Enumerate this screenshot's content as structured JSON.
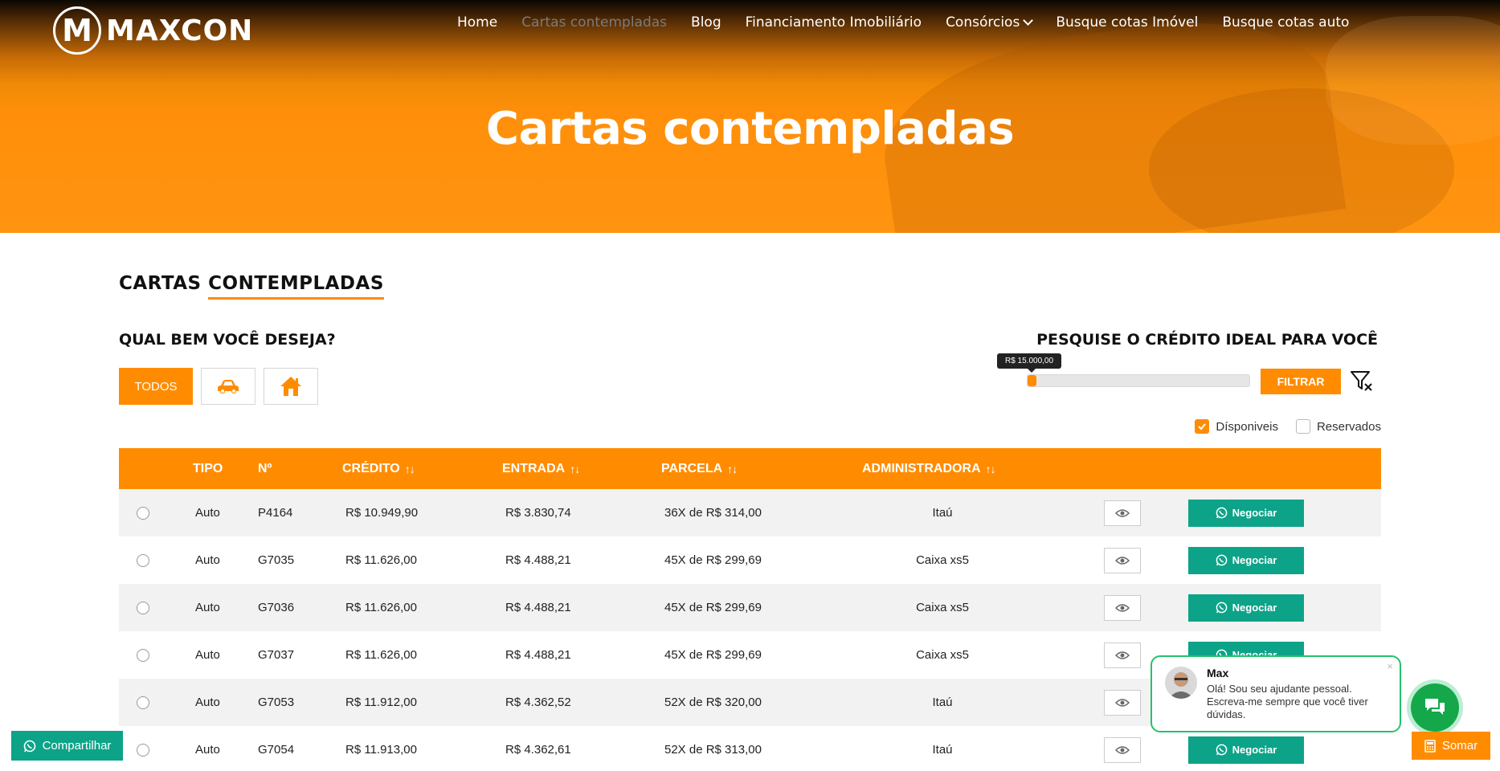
{
  "brand": {
    "logo_letter": "M",
    "name": "MAXCON"
  },
  "nav": {
    "items": [
      {
        "label": "Home",
        "active": false
      },
      {
        "label": "Cartas contempladas",
        "active": true
      },
      {
        "label": "Blog",
        "active": false
      },
      {
        "label": "Financiamento Imobiliário",
        "active": false
      },
      {
        "label": "Consórcios",
        "active": false,
        "dropdown": true
      },
      {
        "label": "Busque cotas Imóvel",
        "active": false
      },
      {
        "label": "Busque cotas auto",
        "active": false
      }
    ]
  },
  "hero": {
    "title": "Cartas contempladas"
  },
  "section": {
    "title_a": "CARTAS ",
    "title_b": "CONTEMPLADAS"
  },
  "filters": {
    "question": "QUAL BEM VOCÊ DESEJA?",
    "all_label": "TODOS",
    "car_icon": "car-icon",
    "house_icon": "house-icon",
    "search_title": "PESQUISE O CRÉDITO IDEAL PARA VOCÊ",
    "slider_value": "R$ 15.000,00",
    "slider_fraction": 0.03,
    "filter_button": "FILTRAR",
    "clear_icon": "filter-clear-icon",
    "available_label": "Dísponiveis",
    "available_checked": true,
    "reserved_label": "Reservados",
    "reserved_checked": false
  },
  "table": {
    "headers": {
      "tipo": "TIPO",
      "numero": "Nº",
      "credito": "CRÉDITO",
      "entrada": "ENTRADA",
      "parcela": "PARCELA",
      "administradora": "ADMINISTRADORA",
      "sort_arrows": "↑↓"
    },
    "negotiate_label": "Negociar",
    "rows": [
      {
        "tipo": "Auto",
        "numero": "P4164",
        "credito": "R$ 10.949,90",
        "entrada": "R$ 3.830,74",
        "parcela": "36X de R$ 314,00",
        "administradora": "Itaú"
      },
      {
        "tipo": "Auto",
        "numero": "G7035",
        "credito": "R$ 11.626,00",
        "entrada": "R$ 4.488,21",
        "parcela": "45X de R$ 299,69",
        "administradora": "Caixa xs5"
      },
      {
        "tipo": "Auto",
        "numero": "G7036",
        "credito": "R$ 11.626,00",
        "entrada": "R$ 4.488,21",
        "parcela": "45X de R$ 299,69",
        "administradora": "Caixa xs5"
      },
      {
        "tipo": "Auto",
        "numero": "G7037",
        "credito": "R$ 11.626,00",
        "entrada": "R$ 4.488,21",
        "parcela": "45X de R$ 299,69",
        "administradora": "Caixa xs5"
      },
      {
        "tipo": "Auto",
        "numero": "G7053",
        "credito": "R$ 11.912,00",
        "entrada": "R$ 4.362,52",
        "parcela": "52X de R$ 320,00",
        "administradora": "Itaú"
      },
      {
        "tipo": "Auto",
        "numero": "G7054",
        "credito": "R$ 11.913,00",
        "entrada": "R$ 4.362,61",
        "parcela": "52X de R$ 313,00",
        "administradora": "Itaú"
      }
    ]
  },
  "share": {
    "label": "Compartilhar"
  },
  "somar": {
    "label": "Somar"
  },
  "chat": {
    "name": "Max",
    "message": "Olá! Sou seu ajudante pessoal. Escreva-me sempre que você tiver dúvidas.",
    "close": "×"
  },
  "colors": {
    "accent": "#ff8c00",
    "green": "#0da388",
    "chat_green": "#25c26a"
  }
}
